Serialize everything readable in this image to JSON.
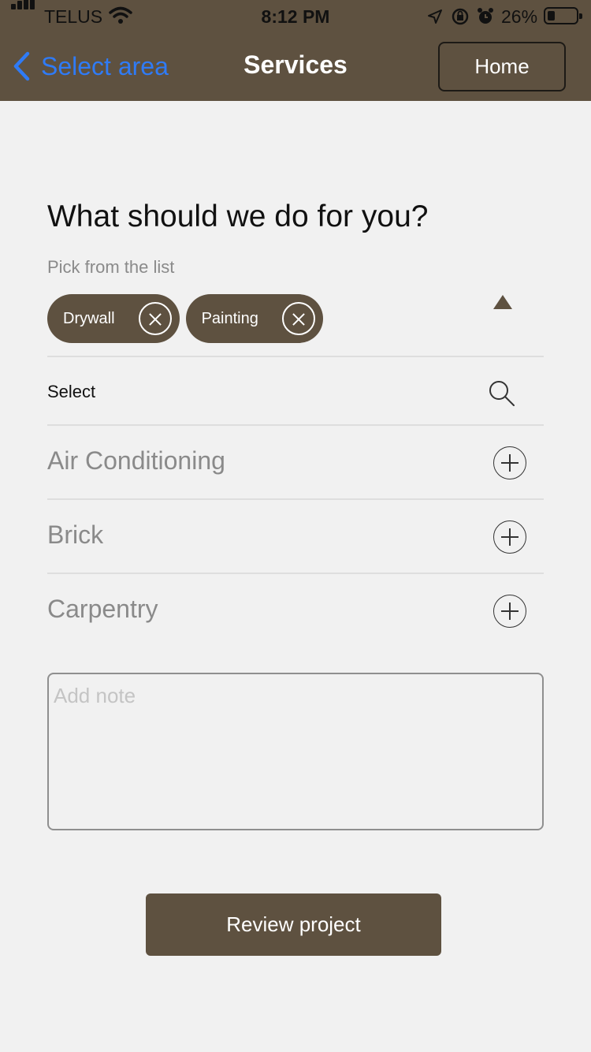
{
  "status_bar": {
    "carrier": "TELUS",
    "time": "8:12 PM",
    "battery_pct": "26%",
    "battery_level": 0.26
  },
  "nav": {
    "back_label": "Select area",
    "title": "Services",
    "home_label": "Home"
  },
  "content": {
    "heading": "What should we do for you?",
    "subheading": "Pick from the list",
    "selected": [
      {
        "label": "Drywall"
      },
      {
        "label": "Painting"
      }
    ],
    "select_label": "Select",
    "services": [
      {
        "label": "Air Conditioning"
      },
      {
        "label": "Brick"
      },
      {
        "label": "Carpentry"
      }
    ],
    "note_placeholder": "Add note",
    "review_label": "Review project"
  },
  "colors": {
    "brand": "#5e5140",
    "link": "#2f7bf6",
    "background": "#f1f1f1"
  }
}
